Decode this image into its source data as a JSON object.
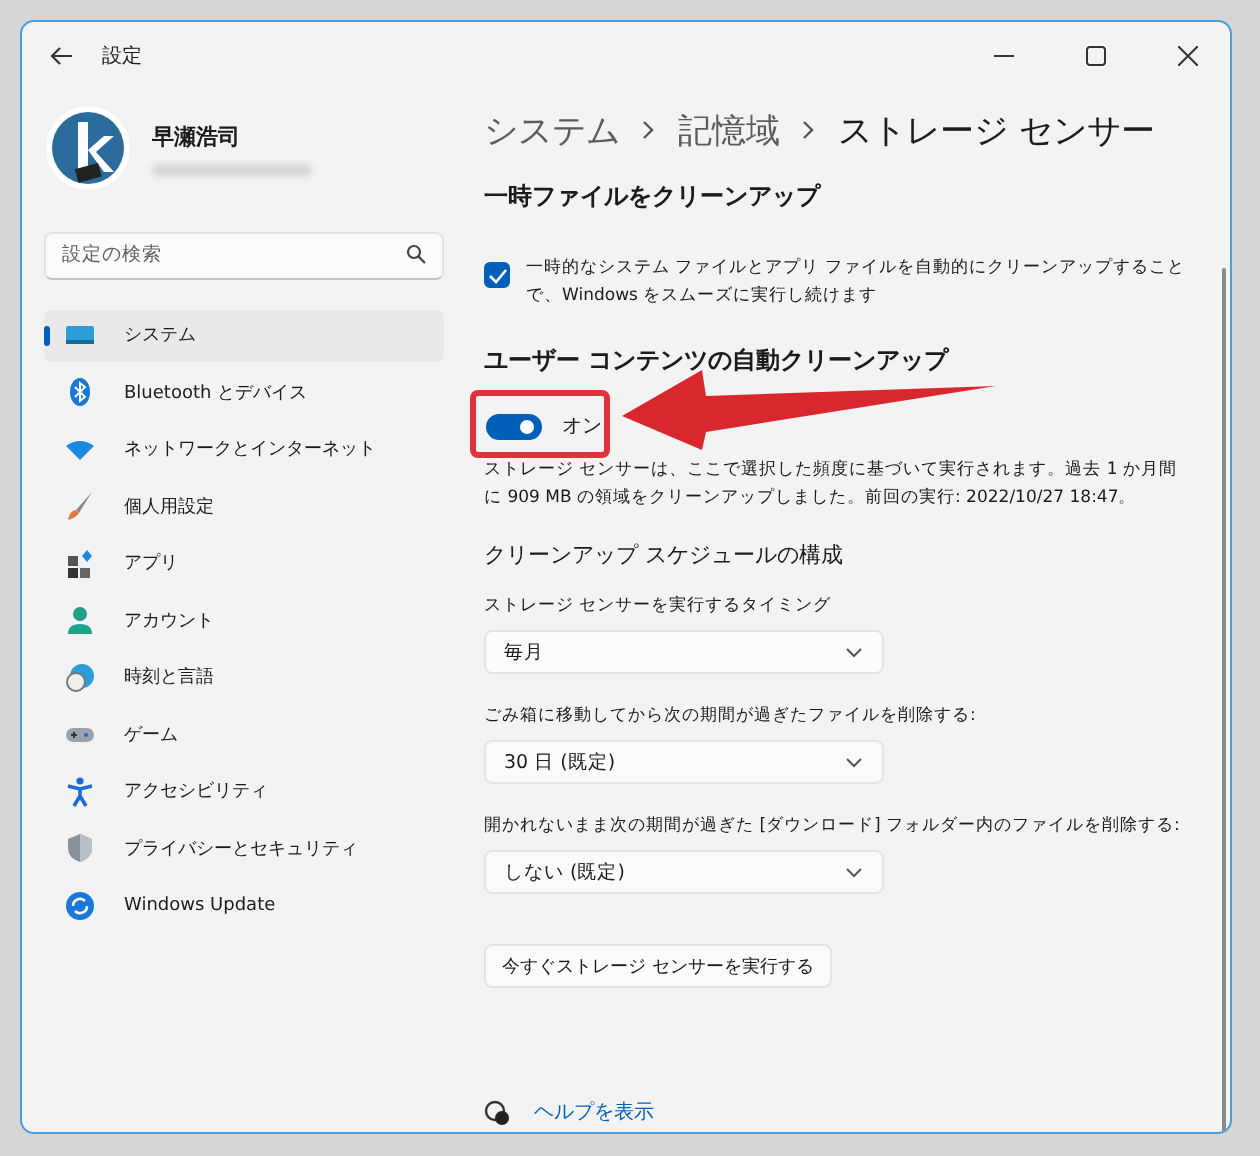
{
  "window": {
    "title": "設定"
  },
  "account": {
    "name": "早瀬浩司"
  },
  "search": {
    "placeholder": "設定の検索"
  },
  "sidebar": {
    "items": [
      {
        "label": "システム",
        "selected": true
      },
      {
        "label": "Bluetooth とデバイス",
        "selected": false
      },
      {
        "label": "ネットワークとインターネット",
        "selected": false
      },
      {
        "label": "個人用設定",
        "selected": false
      },
      {
        "label": "アプリ",
        "selected": false
      },
      {
        "label": "アカウント",
        "selected": false
      },
      {
        "label": "時刻と言語",
        "selected": false
      },
      {
        "label": "ゲーム",
        "selected": false
      },
      {
        "label": "アクセシビリティ",
        "selected": false
      },
      {
        "label": "プライバシーとセキュリティ",
        "selected": false
      },
      {
        "label": "Windows Update",
        "selected": false
      }
    ]
  },
  "breadcrumb": [
    "システム",
    "記憶域",
    "ストレージ センサー"
  ],
  "temp_files": {
    "heading": "一時ファイルをクリーンアップ",
    "checkbox": {
      "label": "一時的なシステム ファイルとアプリ ファイルを自動的にクリーンアップすることで、Windows をスムーズに実行し続けます",
      "checked": true
    }
  },
  "auto_cleanup": {
    "heading": "ユーザー コンテンツの自動クリーンアップ",
    "toggle": {
      "label": "オン",
      "on": true
    },
    "description": "ストレージ センサーは、ここで選択した頻度に基づいて実行されます。過去 1 か月間に 909 MB の領域をクリーンアップしました。前回の実行: 2022/10/27 18:47。"
  },
  "schedule": {
    "heading": "クリーンアップ スケジュールの構成",
    "settings": [
      {
        "label": "ストレージ センサーを実行するタイミング",
        "value": "毎月"
      },
      {
        "label": "ごみ箱に移動してから次の期間が過ぎたファイルを削除する:",
        "value": "30 日 (既定)"
      },
      {
        "label": "開かれないまま次の期間が過ぎた [ダウンロード] フォルダー内のファイルを削除する:",
        "value": "しない (既定)"
      }
    ],
    "run_button": "今すぐストレージ センサーを実行する"
  },
  "help_link": "ヘルプを表示"
}
